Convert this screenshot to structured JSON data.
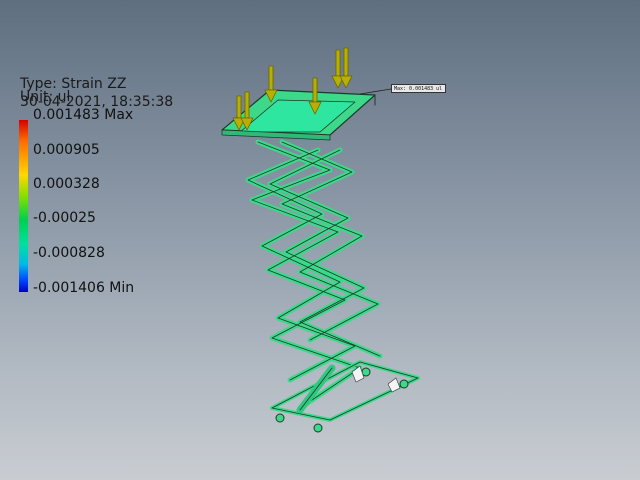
{
  "legend": {
    "type_label": "Type: Strain ZZ",
    "unit_label": "Unit: ul",
    "timestamp": "30-04-2021, 18:35:38",
    "ticks": [
      {
        "label": "0.001483 Max"
      },
      {
        "label": "0.000905"
      },
      {
        "label": "0.000328"
      },
      {
        "label": "-0.00025"
      },
      {
        "label": "-0.000828"
      },
      {
        "label": "-0.001406 Min"
      }
    ]
  },
  "probe": {
    "label": "Max: 0.001483 ul"
  },
  "colors": {
    "frame": "#3ed88a",
    "platform": "#2ee6a0",
    "arrow": "#b8b000",
    "edge": "#1a3a2a"
  }
}
